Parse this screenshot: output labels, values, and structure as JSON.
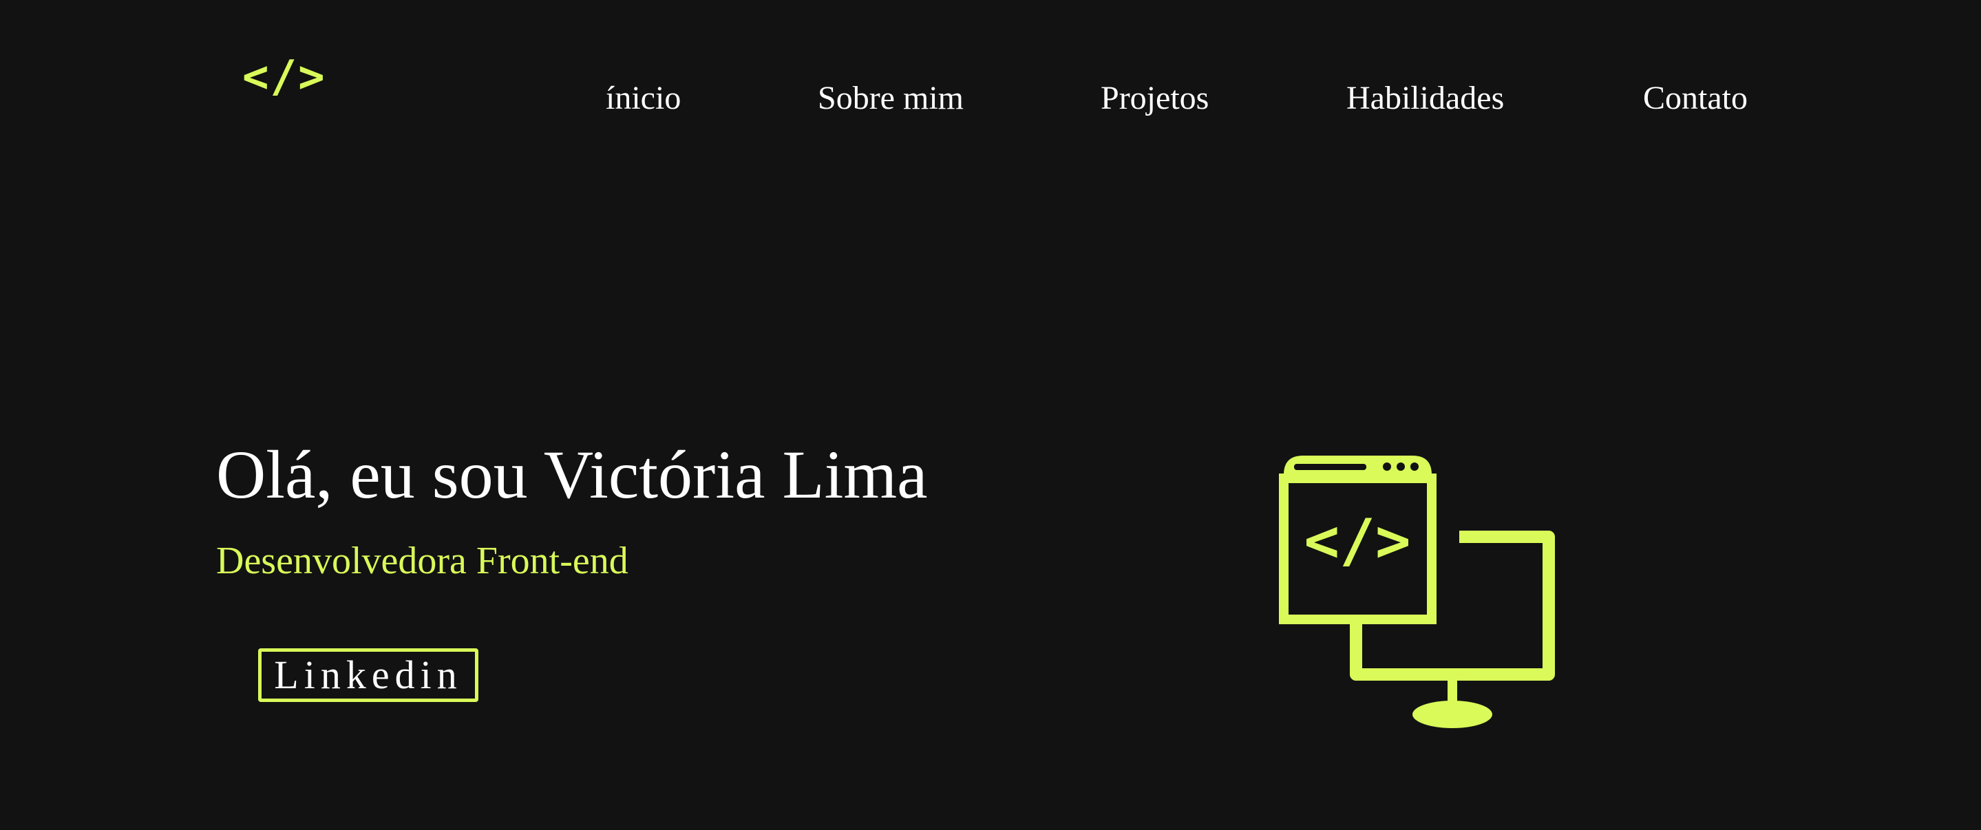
{
  "header": {
    "logo_text": "</>"
  },
  "nav": {
    "items": [
      {
        "label": "ínicio"
      },
      {
        "label": "Sobre mim"
      },
      {
        "label": "Projetos"
      },
      {
        "label": "Habilidades"
      },
      {
        "label": "Contato"
      }
    ]
  },
  "hero": {
    "title": "Olá, eu sou Victória Lima",
    "subtitle": "Desenvolvedora Front-end",
    "button_label": "Linkedin",
    "illustration_icon": "code-monitor-icon",
    "illustration_code_text": "</>"
  },
  "colors": {
    "background": "#121212",
    "accent": "#d9fa59",
    "text": "#ffffff"
  }
}
